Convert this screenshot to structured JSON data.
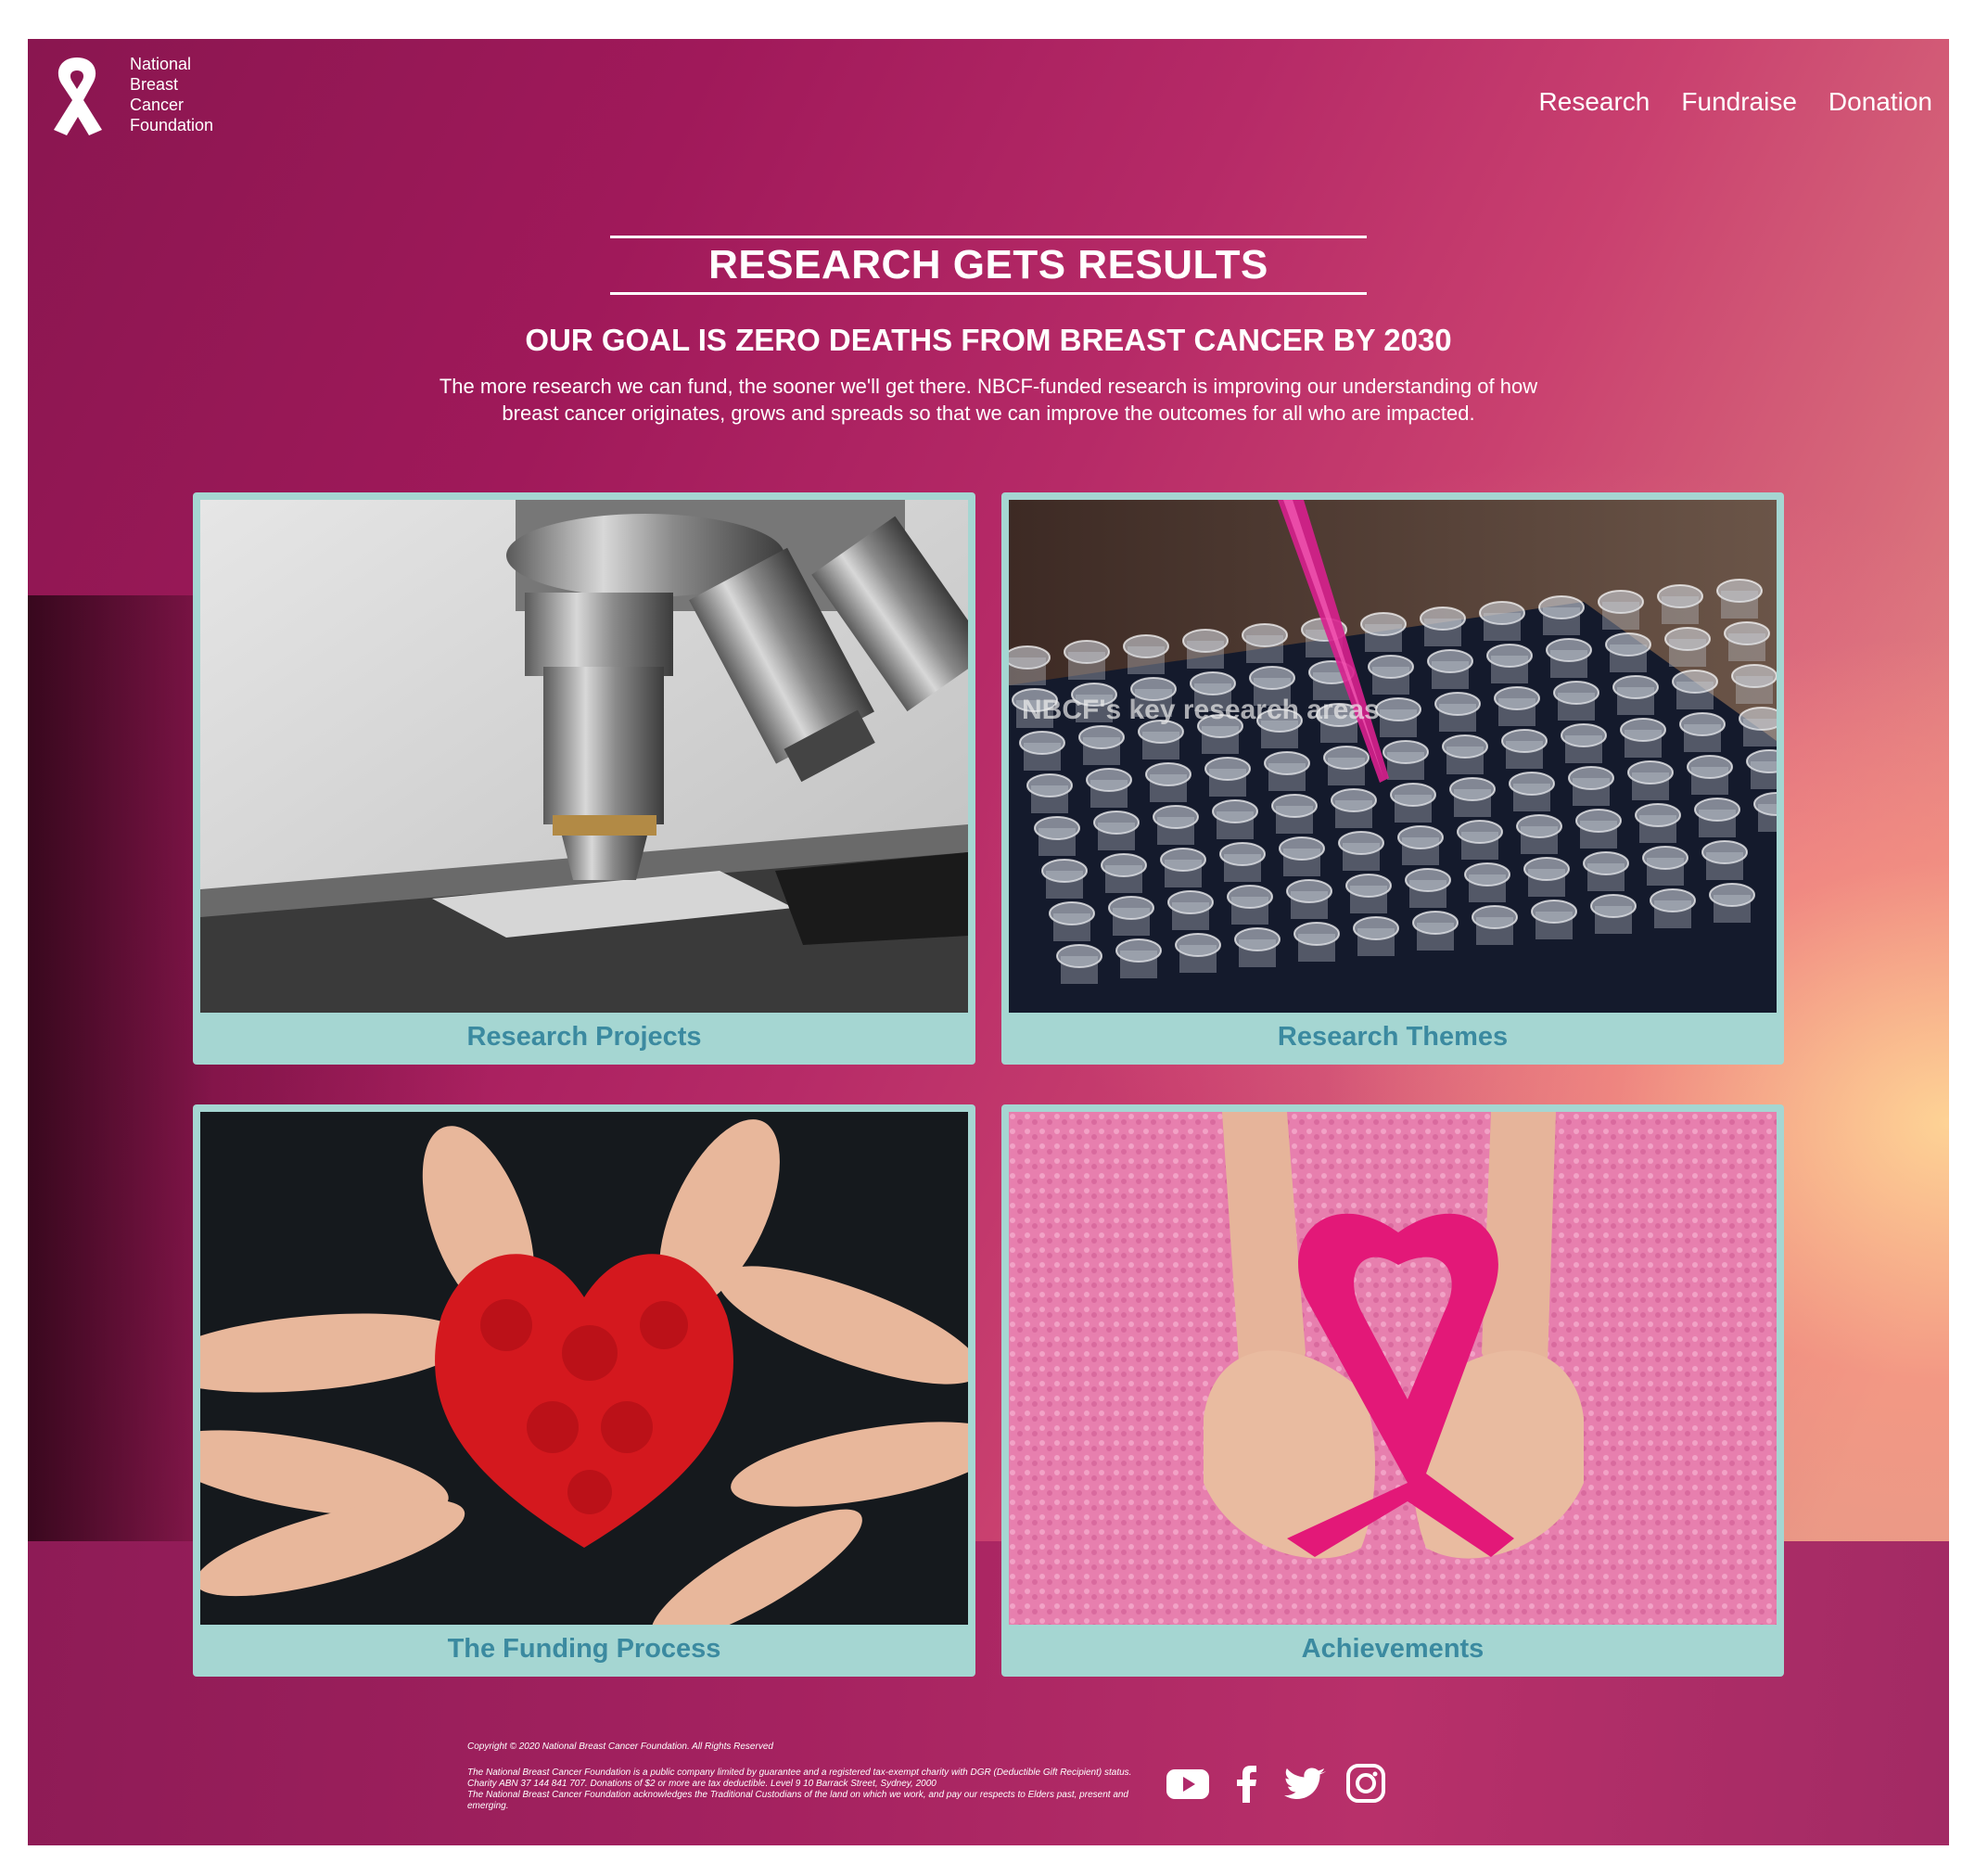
{
  "brand": {
    "logo_lines": [
      "National",
      "Breast",
      "Cancer",
      "Foundation"
    ]
  },
  "nav": {
    "items": [
      {
        "label": "Research"
      },
      {
        "label": "Fundraise"
      },
      {
        "label": "Donation"
      }
    ]
  },
  "hero": {
    "title": "RESEARCH GETS RESULTS",
    "goal": "OUR GOAL IS ZERO DEATHS FROM BREAST CANCER BY 2030",
    "lead": "The more research we can fund, the sooner we'll get there. NBCF-funded research is improving our understanding of how breast cancer originates, grows and spreads so that we can improve the outcomes for all who are impacted."
  },
  "cards": [
    {
      "label": "Research Projects",
      "image": "microscope"
    },
    {
      "label": "Research Themes",
      "image": "pipette-tray",
      "overlay": "NBCF's key research areas"
    },
    {
      "label": "The Funding Process",
      "image": "red-painted-hands"
    },
    {
      "label": "Achievements",
      "image": "pink-ribbon-hands"
    }
  ],
  "footer": {
    "copyright": "Copyright © 2020 National Breast Cancer Foundation. All Rights Reserved",
    "line1": "The National Breast Cancer Foundation is a public company limited by guarantee and a registered tax-exempt charity with DGR (Deductible Gift Recipient) status.",
    "line2": "Charity ABN 37 144 841 707. Donations of $2 or more are tax deductible. Level 9 10 Barrack Street, Sydney, 2000",
    "line3": "The National Breast Cancer Foundation acknowledges the Traditional Custodians of the land on which we work, and pay our respects to Elders past, present and emerging."
  },
  "social": [
    "youtube-icon",
    "facebook-icon",
    "twitter-icon",
    "instagram-icon"
  ],
  "colors": {
    "card_bg": "#a5d6d2",
    "card_label": "#3b8aa0",
    "primary": "#a0195a"
  }
}
